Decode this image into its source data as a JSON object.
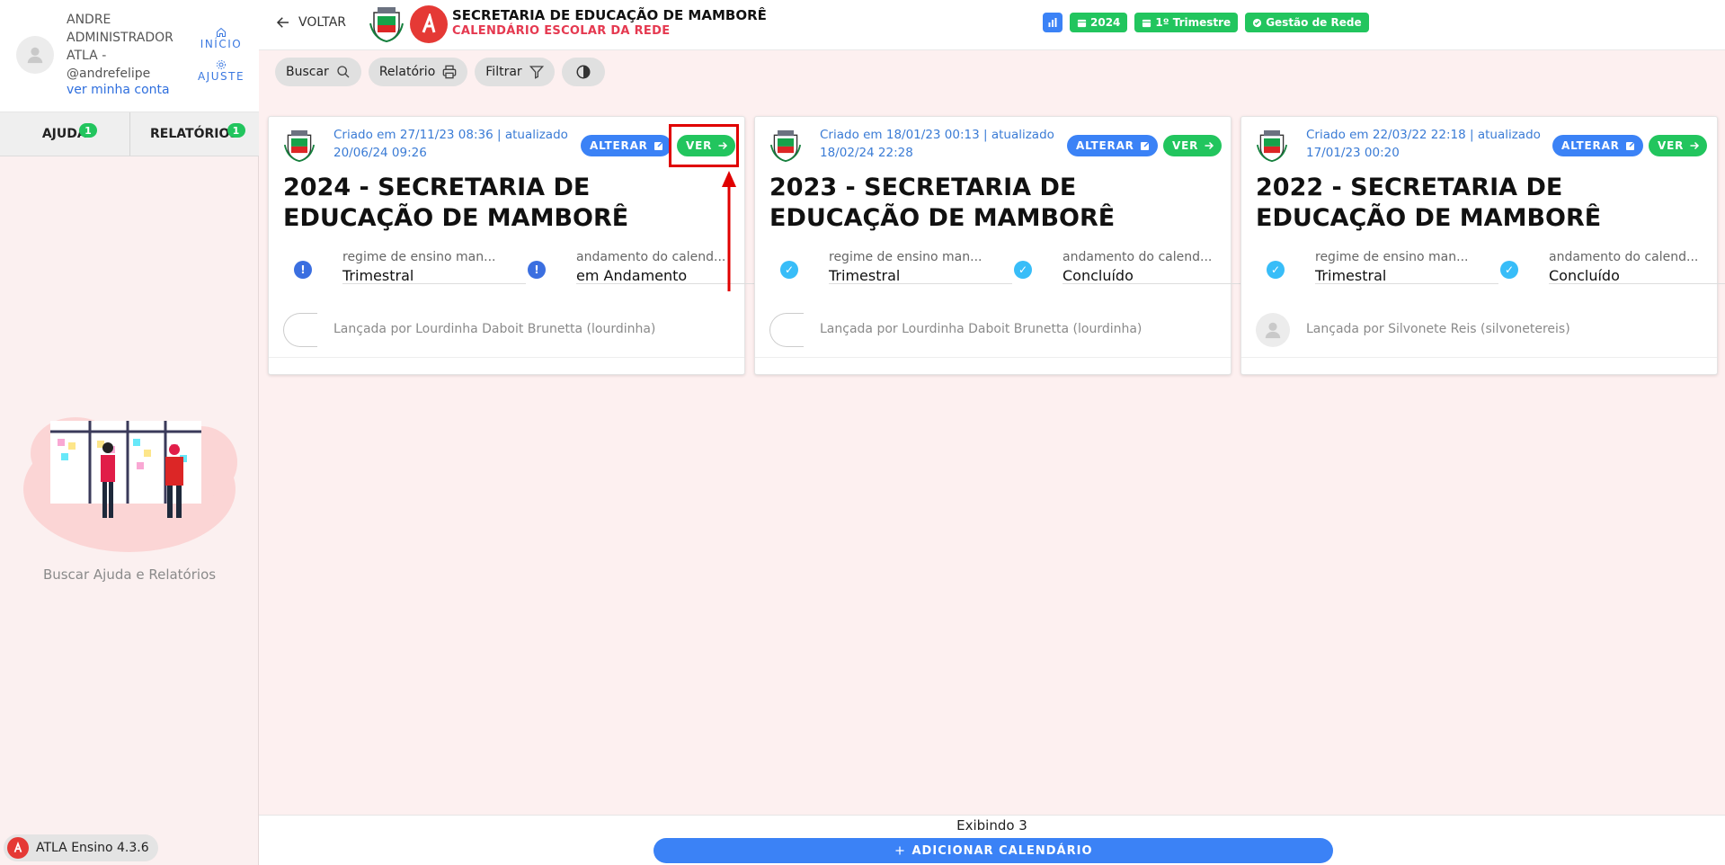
{
  "user": {
    "name": "ANDRE ADMINISTRADOR ATLA - @andrefelipe",
    "account_link": "ver minha conta",
    "home_label": "INÍCIO",
    "settings_label": "AJUSTE"
  },
  "sidebar": {
    "tabs": [
      {
        "label": "AJUDA",
        "badge": "1"
      },
      {
        "label": "RELATÓRIOS",
        "badge": "1"
      }
    ],
    "help_text": "Buscar Ajuda e Relatórios",
    "version": "ATLA Ensino 4.3.6"
  },
  "topbar": {
    "back_label": "VOLTAR",
    "title": "SECRETARIA DE EDUCAÇÃO DE MAMBORÊ",
    "subtitle": "CALENDÁRIO ESCOLAR DA REDE",
    "chips": [
      "2024",
      "1º Trimestre",
      "Gestão de Rede"
    ]
  },
  "toolbar": {
    "search": "Buscar",
    "report": "Relatório",
    "filter": "Filtrar"
  },
  "colors": {
    "accent_blue": "#3b82f6",
    "accent_green": "#22c55e",
    "brand_red": "#e53935",
    "highlight": "#e00000"
  },
  "cards": [
    {
      "meta": "Criado em 27/11/23 08:36 | atualizado 20/06/24 09:26",
      "edit_label": "ALTERAR",
      "view_label": "VER",
      "title": "2024 - SECRETARIA DE EDUCAÇÃO DE MAMBORÊ",
      "regime_label": "regime de ensino man...",
      "regime_value": "Trimestral",
      "status_label": "andamento do calend...",
      "status_value": "em Andamento",
      "status_icon": "alert-icon",
      "author": "Lançada por Lourdinha Daboit Brunetta (lourdinha)"
    },
    {
      "meta": "Criado em 18/01/23 00:13 | atualizado 18/02/24 22:28",
      "edit_label": "ALTERAR",
      "view_label": "VER",
      "title": "2023 - SECRETARIA DE EDUCAÇÃO DE MAMBORÊ",
      "regime_label": "regime de ensino man...",
      "regime_value": "Trimestral",
      "status_label": "andamento do calend...",
      "status_value": "Concluído",
      "status_icon": "check-icon",
      "author": "Lançada por Lourdinha Daboit Brunetta (lourdinha)"
    },
    {
      "meta": "Criado em 22/03/22 22:18 | atualizado 17/01/23 00:20",
      "edit_label": "ALTERAR",
      "view_label": "VER",
      "title": "2022 - SECRETARIA DE EDUCAÇÃO DE MAMBORÊ",
      "regime_label": "regime de ensino man...",
      "regime_value": "Trimestral",
      "status_label": "andamento do calend...",
      "status_value": "Concluído",
      "status_icon": "check-icon",
      "author": "Lançada por Silvonete Reis (silvonetereis)"
    }
  ],
  "footer": {
    "count": "Exibindo 3",
    "add_label": "ADICIONAR CALENDÁRIO"
  }
}
